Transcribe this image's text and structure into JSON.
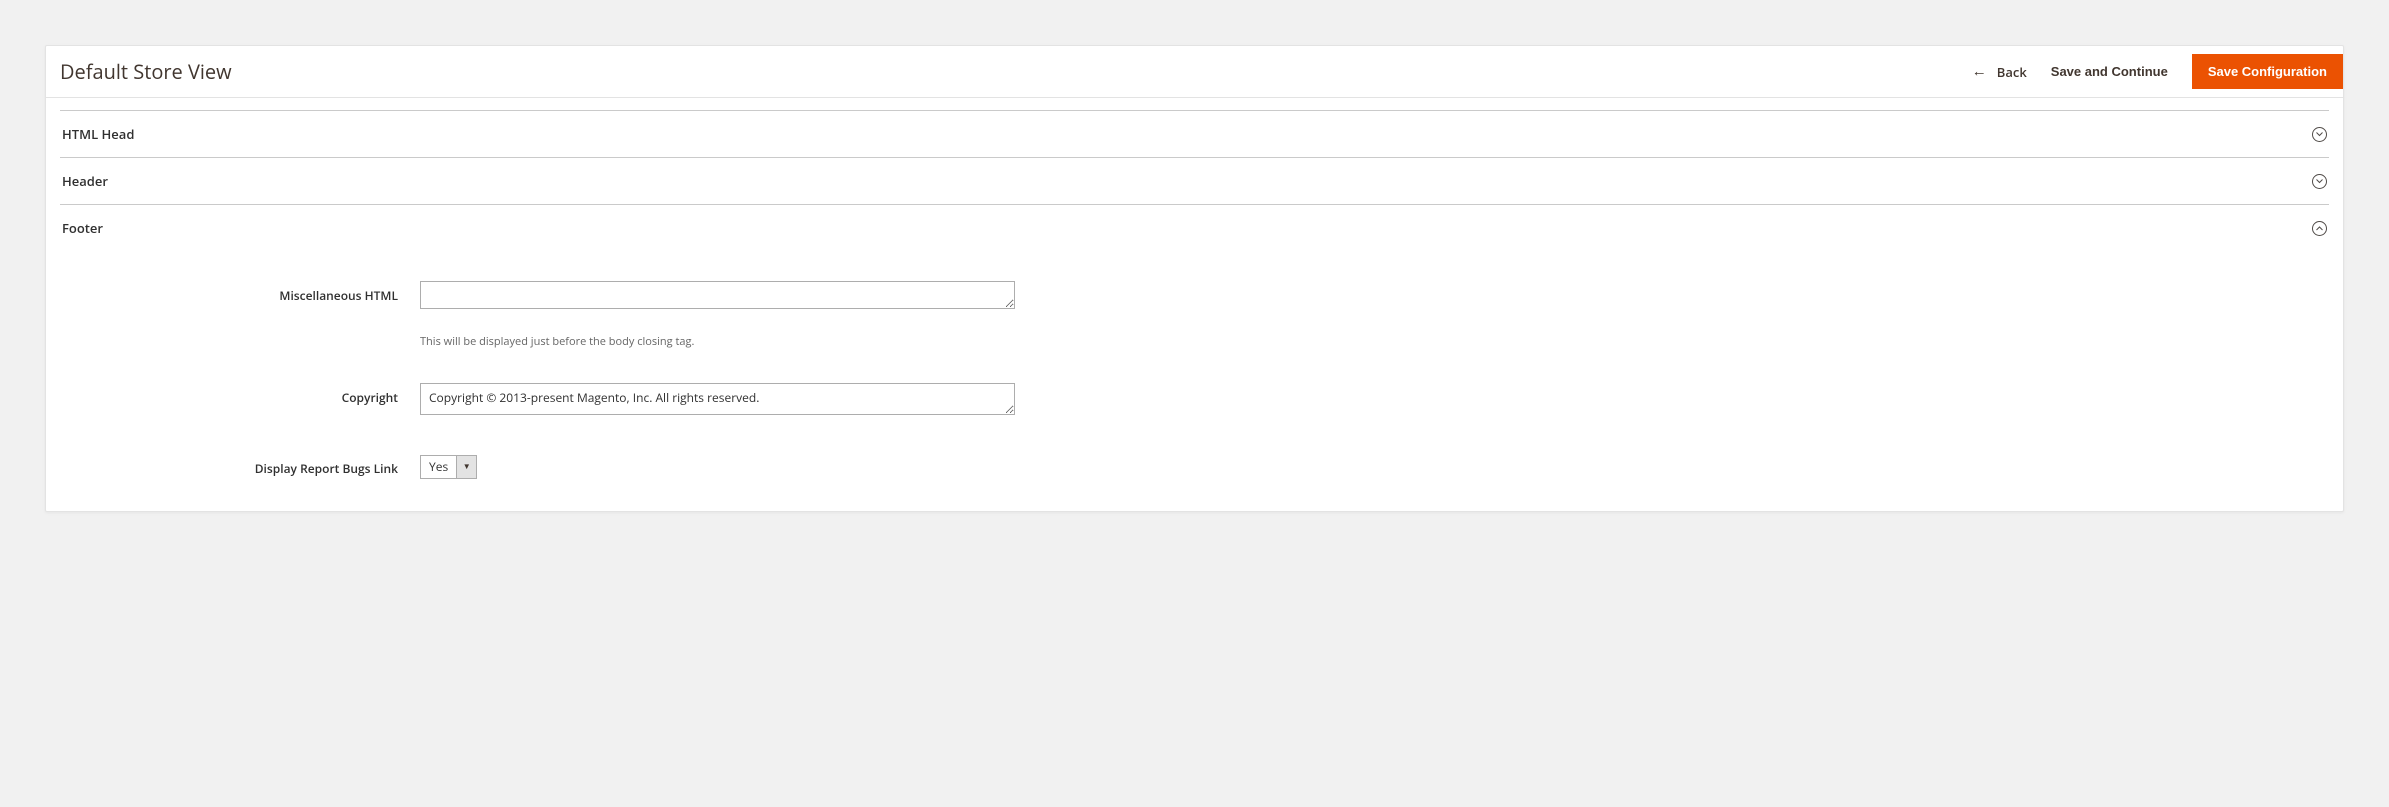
{
  "header": {
    "title": "Default Store View",
    "back_label": "Back",
    "save_continue_label": "Save and Continue",
    "save_config_label": "Save Configuration"
  },
  "sections": {
    "html_head": {
      "title": "HTML Head"
    },
    "header": {
      "title": "Header"
    },
    "footer": {
      "title": "Footer"
    }
  },
  "footer_form": {
    "misc_html": {
      "label": "Miscellaneous HTML",
      "value": "",
      "hint": "This will be displayed just before the body closing tag."
    },
    "copyright": {
      "label": "Copyright",
      "value": "Copyright © 2013-present Magento, Inc. All rights reserved."
    },
    "report_bugs": {
      "label": "Display Report Bugs Link",
      "value": "Yes"
    }
  }
}
